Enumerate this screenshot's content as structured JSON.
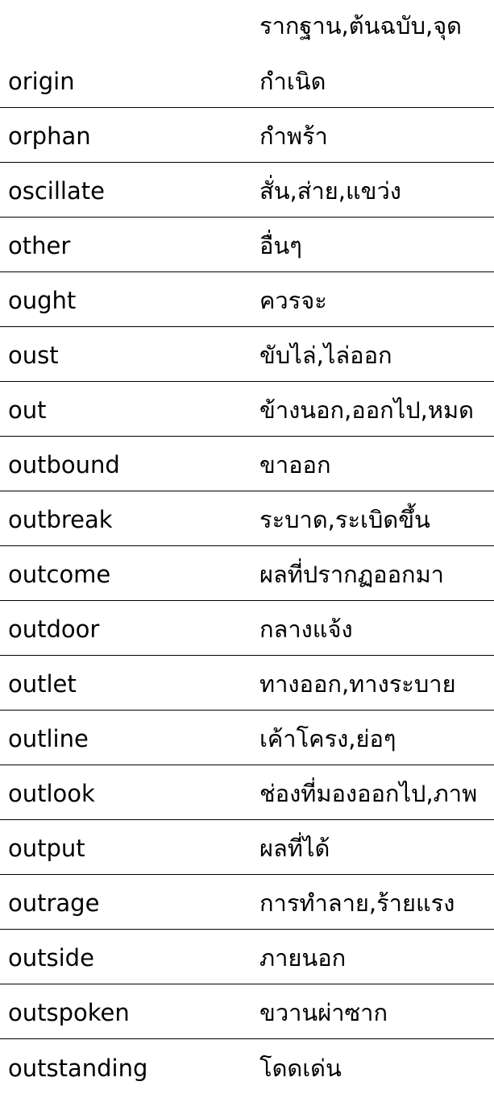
{
  "table": {
    "first_row_meaning_line1": "รากฐาน,ต้นฉบับ,จุด",
    "rows": [
      {
        "word": "origin",
        "meaning": "กำเนิด"
      },
      {
        "word": "orphan",
        "meaning": "กำพร้า"
      },
      {
        "word": "oscillate",
        "meaning": "สั่น,ส่าย,แขว่ง"
      },
      {
        "word": "other",
        "meaning": "อื่นๆ"
      },
      {
        "word": "ought",
        "meaning": "ควรจะ"
      },
      {
        "word": "oust",
        "meaning": "ขับไล่,ไล่ออก"
      },
      {
        "word": "out",
        "meaning": "ข้างนอก,ออกไป,หมด"
      },
      {
        "word": "outbound",
        "meaning": "ขาออก"
      },
      {
        "word": "outbreak",
        "meaning": "ระบาด,ระเบิดขึ้น"
      },
      {
        "word": "outcome",
        "meaning": "ผลที่ปรากฏออกมา"
      },
      {
        "word": "outdoor",
        "meaning": "กลางแจ้ง"
      },
      {
        "word": "outlet",
        "meaning": "ทางออก,ทางระบาย"
      },
      {
        "word": "outline",
        "meaning": "เค้าโครง,ย่อๆ"
      },
      {
        "word": "outlook",
        "meaning": "ช่องที่มองออกไป,ภาพ"
      },
      {
        "word": "output",
        "meaning": "ผลที่ได้"
      },
      {
        "word": "outrage",
        "meaning": "การทำลาย,ร้ายแรง"
      },
      {
        "word": "outside",
        "meaning": "ภายนอก"
      },
      {
        "word": "outspoken",
        "meaning": "ขวานผ่าซาก"
      },
      {
        "word": "outstanding",
        "meaning": "โดดเด่น"
      }
    ]
  }
}
